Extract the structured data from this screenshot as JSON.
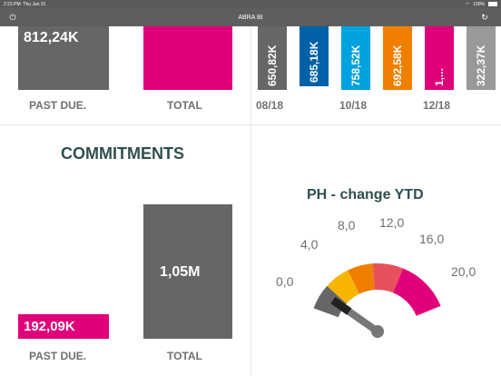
{
  "status": {
    "time": "2:23 PM",
    "date": "Thu Jan 31",
    "battery": "100%"
  },
  "app": {
    "title": "ABRA BI"
  },
  "panel_tl": {
    "past_due_value": "812,24K",
    "past_due_label": "PAST DUE.",
    "total_label": "TOTAL"
  },
  "panel_tr": {
    "bars": [
      {
        "value": "650,82K",
        "color": "#666666"
      },
      {
        "value": "685,18K",
        "color": "#0060a8"
      },
      {
        "value": "758,52K",
        "color": "#00a2e0"
      },
      {
        "value": "692,58K",
        "color": "#f07f00"
      },
      {
        "value": "1,...",
        "color": "#e0007a"
      },
      {
        "value": "322,37K",
        "color": "#999999"
      }
    ],
    "x_labels": [
      "08/18",
      "10/18",
      "12/18"
    ]
  },
  "commitments": {
    "title": "COMMITMENTS",
    "past_due_value": "192,09K",
    "past_due_label": "PAST DUE.",
    "total_value": "1,05M",
    "total_label": "TOTAL"
  },
  "gauge": {
    "title": "PH - change YTD",
    "ticks": [
      "0,0",
      "4,0",
      "8,0",
      "12,0",
      "16,0",
      "20,0"
    ],
    "value": 2.0
  },
  "colors": {
    "gray": "#666666",
    "magenta": "#e0007a"
  }
}
